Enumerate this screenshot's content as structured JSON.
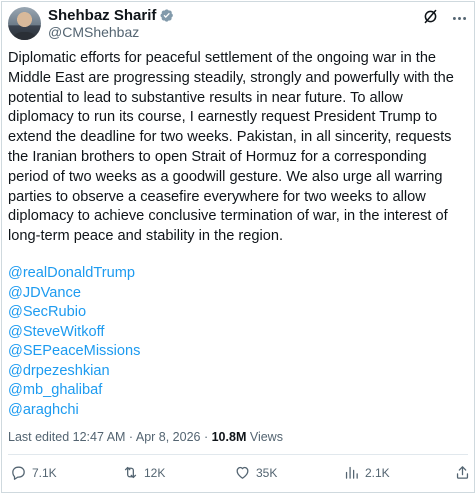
{
  "author": {
    "display_name": "Shehbaz Sharif",
    "handle": "@CMShehbaz",
    "verified": true
  },
  "header_icons": [
    "grok-icon",
    "more-icon"
  ],
  "tweet": {
    "text": "Diplomatic efforts for peaceful settlement of the ongoing war in the Middle East are progressing steadily, strongly and powerfully with the potential to lead to substantive results in near future. To allow diplomacy to run its course, I earnestly request President Trump to extend the deadline for two weeks. Pakistan, in all sincerity, requests the Iranian brothers to open Strait of Hormuz for a corresponding period of two weeks as a goodwill gesture. We also urge all warring parties to observe a ceasefire everywhere for two weeks to allow diplomacy to achieve conclusive termination of war, in the interest of long-term peace and stability in the region.",
    "mentions": [
      "@realDonaldTrump",
      "@JDVance",
      "@SecRubio",
      "@SteveWitkoff",
      "@SEPeaceMissions",
      "@drpezeshkian",
      "@mb_ghalibaf",
      "@araghchi"
    ]
  },
  "meta": {
    "edited_label": "Last edited 12:47 AM · Apr 8, 2026 · ",
    "views_count": "10.8M",
    "views_label": " Views"
  },
  "actions": {
    "replies": "7.1K",
    "reposts": "12K",
    "likes": "35K",
    "views": "2.1K"
  },
  "colors": {
    "link": "#1d9bf0",
    "text": "#0f1419",
    "secondary": "#536471",
    "border": "#cfd9de"
  }
}
